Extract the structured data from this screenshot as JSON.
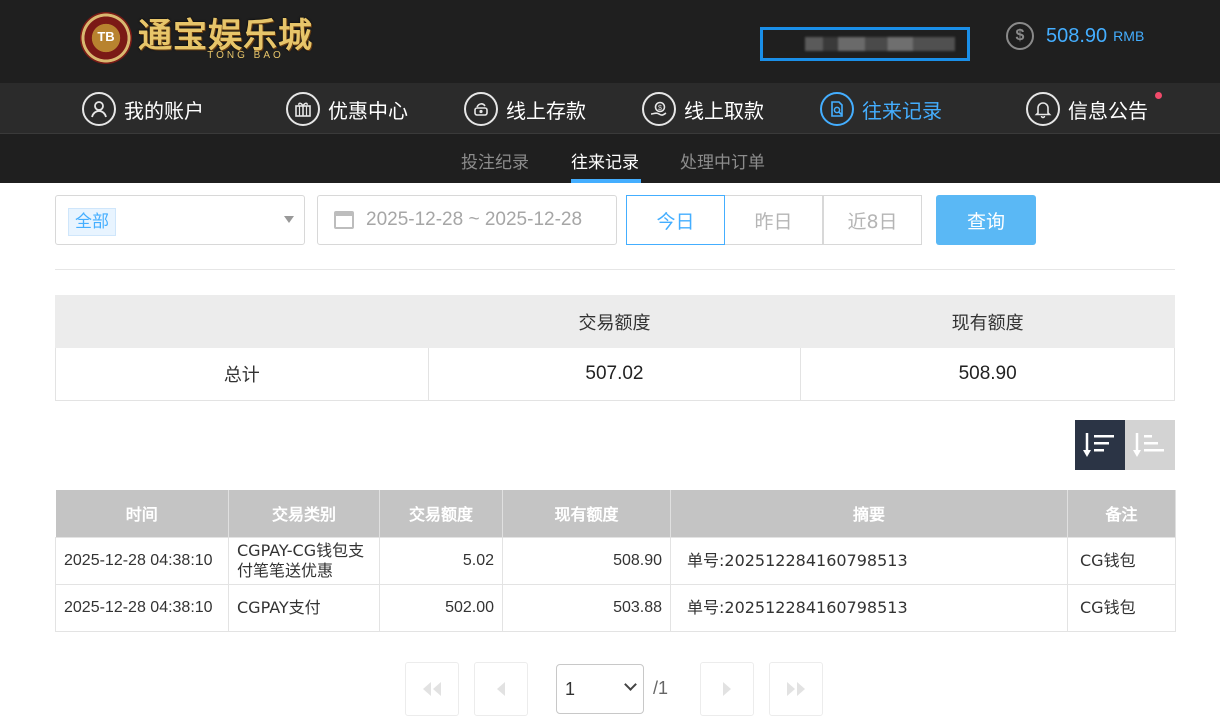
{
  "brand": {
    "chip": "TB",
    "name_cn": "通宝娱乐城",
    "name_en": "TONG BAO"
  },
  "balance": {
    "amount": "508.90",
    "unit": "RMB",
    "icon": "dollar-coin-icon"
  },
  "nav": {
    "items": [
      {
        "label": "我的账户",
        "icon": "user-icon"
      },
      {
        "label": "优惠中心",
        "icon": "gift-icon"
      },
      {
        "label": "线上存款",
        "icon": "deposit-icon"
      },
      {
        "label": "线上取款",
        "icon": "withdraw-icon"
      },
      {
        "label": "往来记录",
        "icon": "record-search-icon"
      },
      {
        "label": "信息公告",
        "icon": "bell-icon"
      }
    ]
  },
  "subnav": {
    "items": [
      "投注纪录",
      "往来记录",
      "处理中订单"
    ]
  },
  "filter": {
    "type_selected": "全部",
    "date_range": "2025-12-28 ~ 2025-12-28",
    "quick": [
      "今日",
      "昨日",
      "近8日"
    ],
    "search_label": "查询"
  },
  "summary": {
    "headers": [
      "",
      "交易额度",
      "现有额度"
    ],
    "row": {
      "label": "总计",
      "trade": "507.02",
      "current": "508.90"
    }
  },
  "table": {
    "headers": [
      "时间",
      "交易类别",
      "交易额度",
      "现有额度",
      "摘要",
      "备注"
    ],
    "rows": [
      {
        "time": "2025-12-28 04:38:10",
        "type": "CGPAY-CG钱包支付笔笔送优惠",
        "amount": "5.02",
        "balance": "508.90",
        "summary": "单号:202512284160798513",
        "note": "CG钱包"
      },
      {
        "time": "2025-12-28 04:38:10",
        "type": "CGPAY支付",
        "amount": "502.00",
        "balance": "503.88",
        "summary": "单号:202512284160798513",
        "note": "CG钱包"
      }
    ]
  },
  "pager": {
    "current": "1",
    "total": "/1"
  },
  "colors": {
    "accent": "#44aeff",
    "header_bg": "#1f1f1f",
    "nav_bg": "#2b2b2b",
    "table_head": "#c4c4c4",
    "notice_dot": "#f04a6a"
  }
}
